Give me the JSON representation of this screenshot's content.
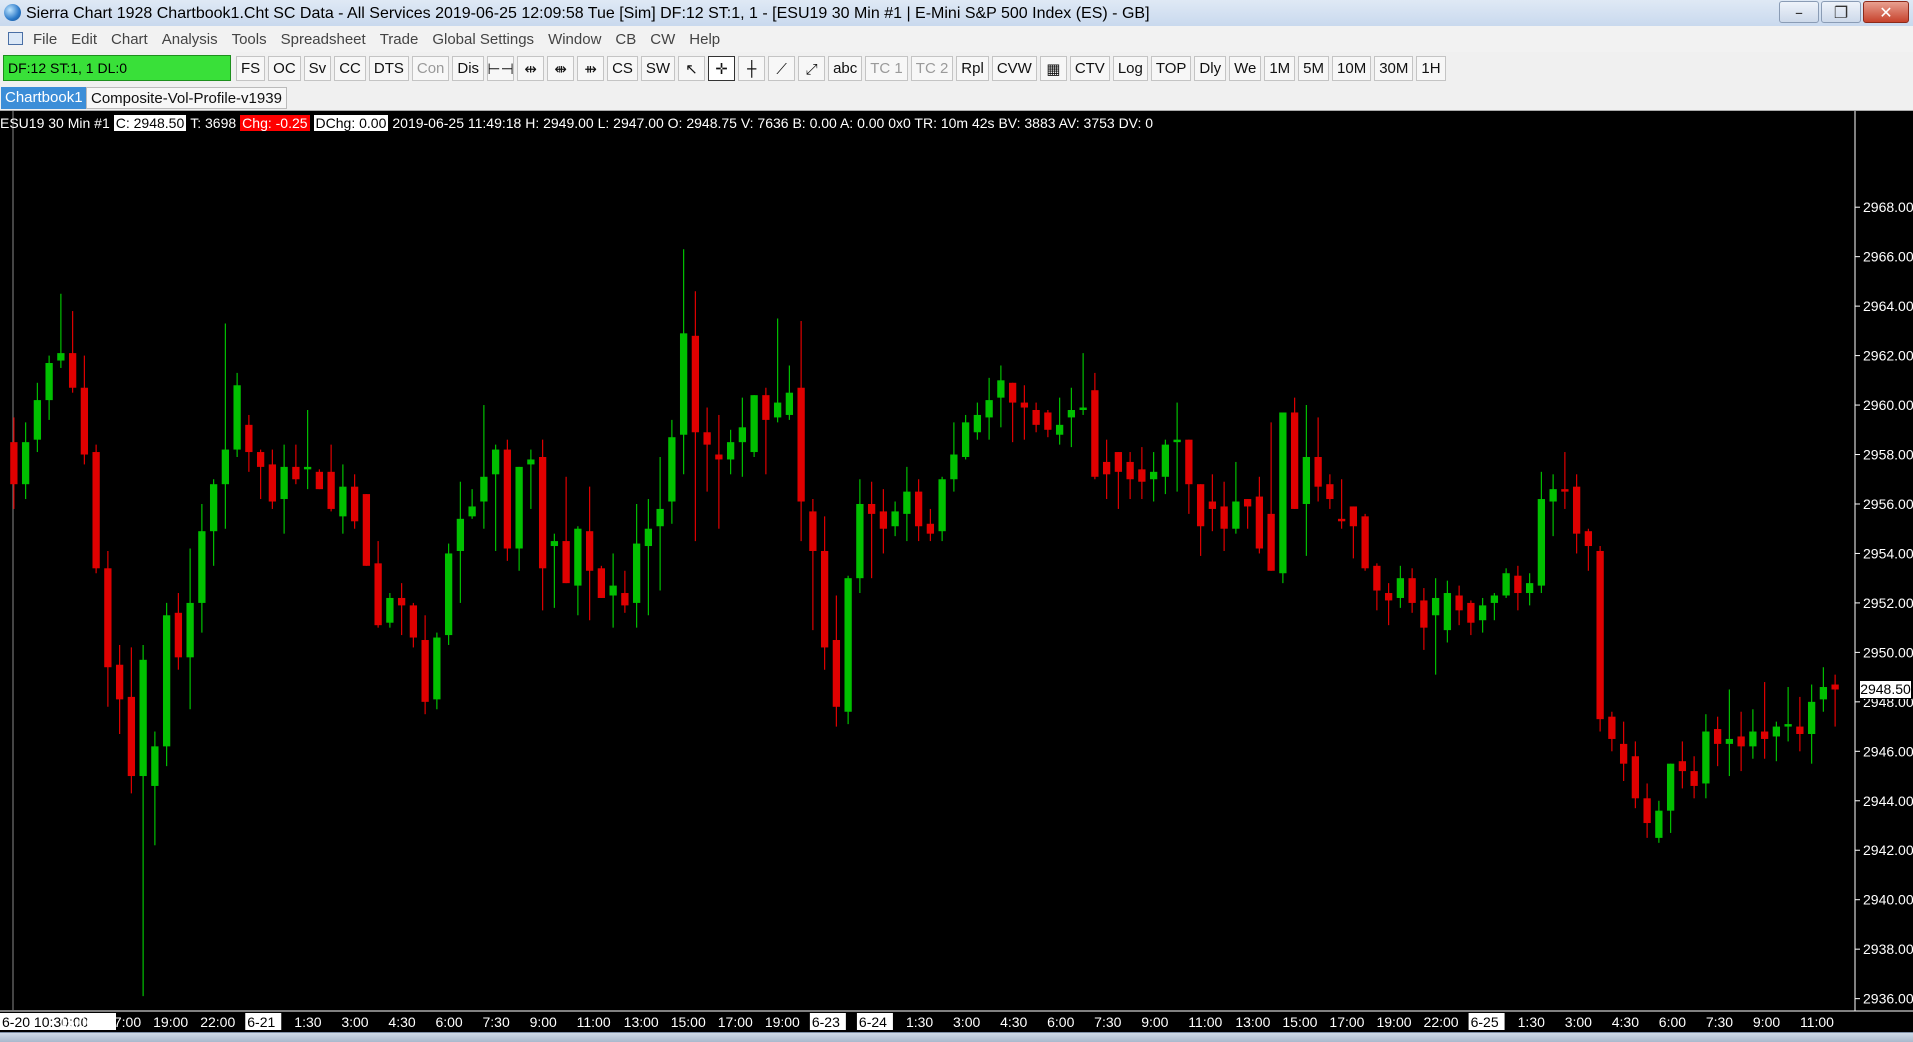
{
  "window": {
    "title": "Sierra Chart 1928 Chartbook1.Cht  SC Data - All Services 2019-06-25  12:09:58 Tue [Sim]  DF:12  ST:1, 1 - [ESU19  30 Min   #1 | E-Mini S&P 500 Index (ES) - GB]",
    "minimize_icon": "minimize-icon",
    "maximize_icon": "restore-icon",
    "close_icon": "close-icon"
  },
  "menu": [
    "File",
    "Edit",
    "Chart",
    "Analysis",
    "Tools",
    "Spreadsheet",
    "Trade",
    "Global Settings",
    "Window",
    "CB",
    "CW",
    "Help"
  ],
  "toolbar": {
    "status": "DF:12  ST:1, 1  DL:0",
    "status_color": "#39e039",
    "buttons": [
      {
        "label": "FS",
        "icon": "",
        "dim": false
      },
      {
        "label": "OC",
        "icon": "",
        "dim": false
      },
      {
        "label": "Sv",
        "icon": "",
        "dim": false
      },
      {
        "label": "CC",
        "icon": "",
        "dim": false
      },
      {
        "label": "DTS",
        "icon": "",
        "dim": false
      },
      {
        "label": "Con",
        "icon": "",
        "dim": true
      },
      {
        "label": "Dis",
        "icon": "",
        "dim": false
      },
      {
        "label": "",
        "icon": "interval-icon",
        "glyph": "⊢⊣",
        "dim": false
      },
      {
        "label": "",
        "icon": "expand-icon",
        "glyph": "⇹",
        "dim": false
      },
      {
        "label": "",
        "icon": "split-icon",
        "glyph": "⇼",
        "dim": false
      },
      {
        "label": "",
        "icon": "split-alt-icon",
        "glyph": "⇻",
        "dim": false
      },
      {
        "label": "CS",
        "icon": "",
        "dim": false
      },
      {
        "label": "SW",
        "icon": "",
        "dim": false
      },
      {
        "label": "",
        "icon": "pointer-icon",
        "glyph": "↖",
        "dim": false
      },
      {
        "label": "",
        "icon": "crosshair-icon",
        "glyph": "✛",
        "dim": false,
        "selected": true
      },
      {
        "label": "",
        "icon": "values-icon",
        "glyph": "┼",
        "dim": false
      },
      {
        "label": "",
        "icon": "line-tool-icon",
        "glyph": "⟋",
        "dim": false
      },
      {
        "label": "",
        "icon": "ray-tool-icon",
        "glyph": "⤢",
        "dim": false
      },
      {
        "label": "abc",
        "icon": "",
        "dim": false
      },
      {
        "label": "TC 1",
        "icon": "",
        "dim": true
      },
      {
        "label": "TC 2",
        "icon": "",
        "dim": true
      },
      {
        "label": "Rpl",
        "icon": "",
        "dim": false
      },
      {
        "label": "CVW",
        "icon": "",
        "dim": false
      },
      {
        "label": "",
        "icon": "calendar-icon",
        "glyph": "▦",
        "dim": false
      },
      {
        "label": "CTV",
        "icon": "",
        "dim": false
      },
      {
        "label": "Log",
        "icon": "",
        "dim": false
      },
      {
        "label": "TOP",
        "icon": "",
        "dim": false
      },
      {
        "label": "Dly",
        "icon": "",
        "dim": false
      },
      {
        "label": "We",
        "icon": "",
        "dim": false
      },
      {
        "label": "1M",
        "icon": "",
        "dim": false
      },
      {
        "label": "5M",
        "icon": "",
        "dim": false
      },
      {
        "label": "10M",
        "icon": "",
        "dim": false
      },
      {
        "label": "30M",
        "icon": "",
        "dim": false
      },
      {
        "label": "1H",
        "icon": "",
        "dim": false
      }
    ]
  },
  "tabs": {
    "active": "Chartbook1",
    "other": "Composite-Vol-Profile-v1939"
  },
  "info": {
    "symbol": "ESU19  30 Min   #1",
    "close": "C: 2948.50",
    "trades": "T: 3698",
    "chg": "Chg: -0.25",
    "dchg": "DChg: 0.00",
    "rest": "2019-06-25 11:49:18 H: 2949.00 L: 2947.00 O: 2948.75 V: 7636 B: 0.00 A: 0.00 0x0 TR: 10m 42s BV: 3883 AV: 3753 DV: 0"
  },
  "chart_data": {
    "type": "candlestick",
    "symbol": "ESU19",
    "interval": "30 Min",
    "last_price": "2948.50",
    "up_color": "#00c000",
    "down_color": "#e00000",
    "y_ticks": [
      "2968.00",
      "2966.00",
      "2964.00",
      "2962.00",
      "2960.00",
      "2958.00",
      "2956.00",
      "2954.00",
      "2952.00",
      "2950.00",
      "2948.00",
      "2946.00",
      "2944.00",
      "2942.00",
      "2940.00",
      "2938.00",
      "2936.00"
    ],
    "ylim": [
      2935.5,
      2971
    ],
    "x_ticks": [
      {
        "label": "6-20  10:30:00",
        "date": true
      },
      {
        "label": "15:00"
      },
      {
        "label": "17:00"
      },
      {
        "label": "19:00"
      },
      {
        "label": "22:00"
      },
      {
        "label": "6-21",
        "date": true
      },
      {
        "label": "1:30"
      },
      {
        "label": "3:00"
      },
      {
        "label": "4:30"
      },
      {
        "label": "6:00"
      },
      {
        "label": "7:30"
      },
      {
        "label": "9:00"
      },
      {
        "label": "11:00"
      },
      {
        "label": "13:00"
      },
      {
        "label": "15:00"
      },
      {
        "label": "17:00"
      },
      {
        "label": "19:00"
      },
      {
        "label": "6-23",
        "date": true
      },
      {
        "label": "6-24",
        "date": true
      },
      {
        "label": "1:30"
      },
      {
        "label": "3:00"
      },
      {
        "label": "4:30"
      },
      {
        "label": "6:00"
      },
      {
        "label": "7:30"
      },
      {
        "label": "9:00"
      },
      {
        "label": "11:00"
      },
      {
        "label": "13:00"
      },
      {
        "label": "15:00"
      },
      {
        "label": "17:00"
      },
      {
        "label": "19:00"
      },
      {
        "label": "22:00"
      },
      {
        "label": "6-25",
        "date": true
      },
      {
        "label": "1:30"
      },
      {
        "label": "3:00"
      },
      {
        "label": "4:30"
      },
      {
        "label": "6:00"
      },
      {
        "label": "7:30"
      },
      {
        "label": "9:00"
      },
      {
        "label": "11:00"
      }
    ],
    "candles": [
      [
        2958.5,
        2959.5,
        2955.8,
        2956.8
      ],
      [
        2956.8,
        2959.3,
        2956.2,
        2958.5
      ],
      [
        2958.6,
        2960.9,
        2958.1,
        2960.2
      ],
      [
        2960.2,
        2962.0,
        2959.4,
        2961.7
      ],
      [
        2961.8,
        2964.5,
        2961.5,
        2962.1
      ],
      [
        2962.1,
        2963.8,
        2960.5,
        2960.7
      ],
      [
        2960.7,
        2962.0,
        2957.6,
        2958.0
      ],
      [
        2958.1,
        2958.4,
        2953.2,
        2953.4
      ],
      [
        2953.4,
        2954.1,
        2947.8,
        2949.4
      ],
      [
        2949.5,
        2950.3,
        2946.7,
        2948.1
      ],
      [
        2948.2,
        2950.2,
        2944.3,
        2945.0
      ],
      [
        2945.0,
        2950.3,
        2936.1,
        2949.7
      ],
      [
        2944.6,
        2946.8,
        2942.2,
        2946.2
      ],
      [
        2946.2,
        2952.0,
        2945.4,
        2951.5
      ],
      [
        2951.6,
        2952.4,
        2949.3,
        2949.8
      ],
      [
        2949.8,
        2954.2,
        2947.7,
        2952.0
      ],
      [
        2952.0,
        2956.0,
        2950.8,
        2954.9
      ],
      [
        2954.9,
        2957.0,
        2953.5,
        2956.8
      ],
      [
        2956.8,
        2963.3,
        2955.0,
        2958.2
      ],
      [
        2958.2,
        2961.3,
        2957.9,
        2960.8
      ],
      [
        2959.2,
        2959.6,
        2957.3,
        2958.1
      ],
      [
        2958.1,
        2958.2,
        2956.2,
        2957.5
      ],
      [
        2957.6,
        2958.2,
        2955.8,
        2956.1
      ],
      [
        2956.2,
        2958.4,
        2954.8,
        2957.5
      ],
      [
        2957.5,
        2958.4,
        2956.8,
        2957.0
      ],
      [
        2957.4,
        2959.8,
        2956.6,
        2957.5
      ],
      [
        2957.3,
        2957.4,
        2956.8,
        2956.6
      ],
      [
        2957.3,
        2958.4,
        2955.7,
        2955.8
      ],
      [
        2955.5,
        2957.6,
        2954.8,
        2956.7
      ],
      [
        2956.7,
        2957.2,
        2955.0,
        2955.3
      ],
      [
        2956.4,
        2956.4,
        2953.7,
        2953.5
      ],
      [
        2953.6,
        2954.5,
        2951.0,
        2951.1
      ],
      [
        2951.2,
        2952.4,
        2951.0,
        2952.2
      ],
      [
        2952.2,
        2952.8,
        2950.7,
        2951.9
      ],
      [
        2951.9,
        2952.0,
        2950.2,
        2950.6
      ],
      [
        2950.5,
        2951.5,
        2947.5,
        2948.0
      ],
      [
        2948.1,
        2950.8,
        2947.7,
        2950.6
      ],
      [
        2950.7,
        2954.4,
        2950.3,
        2954.0
      ],
      [
        2954.1,
        2956.9,
        2952.0,
        2955.4
      ],
      [
        2955.5,
        2956.6,
        2955.4,
        2955.9
      ],
      [
        2956.1,
        2960.0,
        2955.0,
        2957.1
      ],
      [
        2957.2,
        2958.4,
        2954.1,
        2958.2
      ],
      [
        2958.2,
        2958.6,
        2953.7,
        2954.2
      ],
      [
        2954.2,
        2957.1,
        2953.3,
        2957.5
      ],
      [
        2957.6,
        2958.2,
        2955.8,
        2957.8
      ],
      [
        2957.9,
        2958.6,
        2951.7,
        2953.4
      ],
      [
        2954.3,
        2954.8,
        2951.8,
        2954.5
      ],
      [
        2954.5,
        2957.1,
        2953.2,
        2952.8
      ],
      [
        2952.7,
        2955.1,
        2951.5,
        2955.0
      ],
      [
        2954.9,
        2956.7,
        2951.3,
        2953.3
      ],
      [
        2953.4,
        2953.5,
        2952.2,
        2952.2
      ],
      [
        2952.3,
        2954.0,
        2951.0,
        2952.7
      ],
      [
        2952.4,
        2953.3,
        2951.6,
        2951.9
      ],
      [
        2952.0,
        2956.0,
        2951.0,
        2954.4
      ],
      [
        2954.3,
        2956.2,
        2951.5,
        2955.0
      ],
      [
        2955.1,
        2957.9,
        2952.5,
        2955.8
      ],
      [
        2956.1,
        2959.4,
        2955.2,
        2958.7
      ],
      [
        2958.8,
        2966.3,
        2957.2,
        2962.9
      ],
      [
        2962.8,
        2964.6,
        2954.5,
        2958.9
      ],
      [
        2958.9,
        2959.9,
        2956.5,
        2958.4
      ],
      [
        2958.0,
        2959.6,
        2955.0,
        2957.8
      ],
      [
        2957.8,
        2959.0,
        2957.2,
        2958.5
      ],
      [
        2958.5,
        2960.3,
        2957.1,
        2959.1
      ],
      [
        2958.1,
        2960.1,
        2957.9,
        2960.4
      ],
      [
        2960.4,
        2960.7,
        2957.2,
        2959.4
      ],
      [
        2959.5,
        2963.5,
        2959.3,
        2960.1
      ],
      [
        2959.6,
        2961.6,
        2959.4,
        2960.5
      ],
      [
        2960.7,
        2963.4,
        2954.5,
        2956.1
      ],
      [
        2955.7,
        2956.2,
        2950.9,
        2954.1
      ],
      [
        2954.1,
        2955.5,
        2949.3,
        2950.2
      ],
      [
        2950.5,
        2952.3,
        2947.0,
        2947.8
      ],
      [
        2947.6,
        2953.1,
        2947.1,
        2953.0
      ],
      [
        2953.0,
        2957.0,
        2952.4,
        2956.0
      ],
      [
        2956.0,
        2956.9,
        2953.0,
        2955.6
      ],
      [
        2955.7,
        2956.6,
        2954.0,
        2955.0
      ],
      [
        2955.1,
        2956.1,
        2954.7,
        2955.7
      ],
      [
        2955.6,
        2957.5,
        2954.5,
        2956.5
      ],
      [
        2956.5,
        2957.0,
        2954.5,
        2955.1
      ],
      [
        2955.2,
        2955.8,
        2954.5,
        2954.8
      ],
      [
        2954.9,
        2957.1,
        2954.5,
        2957.0
      ],
      [
        2957.0,
        2959.3,
        2956.5,
        2958.0
      ],
      [
        2957.9,
        2959.6,
        2957.8,
        2959.3
      ],
      [
        2958.9,
        2960.1,
        2958.6,
        2959.6
      ],
      [
        2959.5,
        2961.1,
        2958.6,
        2960.2
      ],
      [
        2960.3,
        2961.6,
        2959.1,
        2961.0
      ],
      [
        2960.9,
        2960.4,
        2958.5,
        2960.1
      ],
      [
        2960.1,
        2960.8,
        2958.6,
        2959.9
      ],
      [
        2959.8,
        2960.1,
        2958.9,
        2959.2
      ],
      [
        2959.7,
        2959.8,
        2958.7,
        2959.0
      ],
      [
        2958.8,
        2960.3,
        2958.4,
        2959.2
      ],
      [
        2959.5,
        2960.7,
        2958.3,
        2959.8
      ],
      [
        2959.8,
        2962.1,
        2959.6,
        2959.9
      ],
      [
        2960.6,
        2961.3,
        2957.0,
        2957.1
      ],
      [
        2957.7,
        2958.6,
        2956.2,
        2957.2
      ],
      [
        2958.1,
        2958.1,
        2955.8,
        2957.3
      ],
      [
        2957.7,
        2958.1,
        2956.2,
        2957.0
      ],
      [
        2957.4,
        2958.3,
        2956.2,
        2956.9
      ],
      [
        2957.0,
        2958.1,
        2956.1,
        2957.3
      ],
      [
        2957.1,
        2958.6,
        2956.4,
        2958.4
      ],
      [
        2958.5,
        2960.1,
        2956.5,
        2958.6
      ],
      [
        2958.6,
        2958.0,
        2955.6,
        2956.8
      ],
      [
        2956.8,
        2956.7,
        2953.9,
        2955.1
      ],
      [
        2956.1,
        2957.2,
        2954.9,
        2955.8
      ],
      [
        2955.9,
        2956.9,
        2954.1,
        2955.0
      ],
      [
        2955.0,
        2957.7,
        2954.8,
        2956.1
      ],
      [
        2956.2,
        2956.1,
        2955.0,
        2955.9
      ],
      [
        2956.3,
        2957.1,
        2954.0,
        2954.2
      ],
      [
        2955.6,
        2959.3,
        2953.6,
        2953.3
      ],
      [
        2953.2,
        2954.6,
        2952.8,
        2959.7
      ],
      [
        2959.7,
        2960.3,
        2956.1,
        2955.8
      ],
      [
        2956.0,
        2960.0,
        2953.9,
        2957.9
      ],
      [
        2957.9,
        2959.5,
        2956.1,
        2956.7
      ],
      [
        2956.8,
        2957.2,
        2955.8,
        2956.2
      ],
      [
        2955.4,
        2957.0,
        2955.0,
        2955.3
      ],
      [
        2955.9,
        2955.6,
        2953.8,
        2955.1
      ],
      [
        2955.5,
        2955.6,
        2953.3,
        2953.4
      ],
      [
        2953.5,
        2953.6,
        2951.7,
        2952.5
      ],
      [
        2952.4,
        2952.8,
        2951.1,
        2952.1
      ],
      [
        2952.2,
        2953.5,
        2951.8,
        2953.0
      ],
      [
        2953.0,
        2953.4,
        2951.6,
        2952.0
      ],
      [
        2952.1,
        2952.6,
        2950.1,
        2951.0
      ],
      [
        2951.5,
        2953.0,
        2949.1,
        2952.2
      ],
      [
        2950.9,
        2952.9,
        2950.4,
        2952.4
      ],
      [
        2952.3,
        2952.7,
        2951.1,
        2951.7
      ],
      [
        2952.0,
        2952.1,
        2950.7,
        2951.2
      ],
      [
        2951.3,
        2952.2,
        2950.8,
        2951.9
      ],
      [
        2952.0,
        2952.4,
        2951.3,
        2952.3
      ],
      [
        2952.3,
        2953.4,
        2952.2,
        2953.2
      ],
      [
        2953.1,
        2953.5,
        2951.7,
        2952.4
      ],
      [
        2952.4,
        2953.2,
        2951.9,
        2952.8
      ],
      [
        2952.7,
        2957.3,
        2952.4,
        2956.2
      ],
      [
        2956.1,
        2957.2,
        2954.7,
        2956.6
      ],
      [
        2956.6,
        2958.1,
        2955.8,
        2956.5
      ],
      [
        2956.7,
        2957.2,
        2954.0,
        2954.8
      ],
      [
        2954.9,
        2955.0,
        2953.3,
        2954.3
      ],
      [
        2954.1,
        2954.3,
        2946.8,
        2947.3
      ],
      [
        2947.4,
        2947.6,
        2946.0,
        2946.5
      ],
      [
        2946.3,
        2947.2,
        2944.8,
        2945.5
      ],
      [
        2945.8,
        2946.4,
        2943.7,
        2944.1
      ],
      [
        2944.1,
        2944.7,
        2942.5,
        2943.1
      ],
      [
        2942.5,
        2944.0,
        2942.3,
        2943.6
      ],
      [
        2943.6,
        2945.3,
        2942.7,
        2945.5
      ],
      [
        2945.6,
        2946.4,
        2944.5,
        2945.2
      ],
      [
        2945.2,
        2945.8,
        2944.1,
        2944.6
      ],
      [
        2944.7,
        2947.5,
        2944.1,
        2946.8
      ],
      [
        2946.9,
        2947.4,
        2945.4,
        2946.3
      ],
      [
        2946.3,
        2948.5,
        2945.0,
        2946.5
      ],
      [
        2946.6,
        2947.6,
        2945.2,
        2946.2
      ],
      [
        2946.2,
        2947.7,
        2945.7,
        2946.8
      ],
      [
        2946.8,
        2948.8,
        2945.7,
        2946.5
      ],
      [
        2946.6,
        2947.2,
        2945.6,
        2947.0
      ],
      [
        2947.0,
        2948.6,
        2946.4,
        2947.1
      ],
      [
        2947.0,
        2948.2,
        2946.0,
        2946.7
      ],
      [
        2946.7,
        2948.7,
        2945.5,
        2948.0
      ],
      [
        2948.1,
        2949.4,
        2947.6,
        2948.6
      ],
      [
        2948.7,
        2949.1,
        2947.0,
        2948.5
      ]
    ]
  }
}
